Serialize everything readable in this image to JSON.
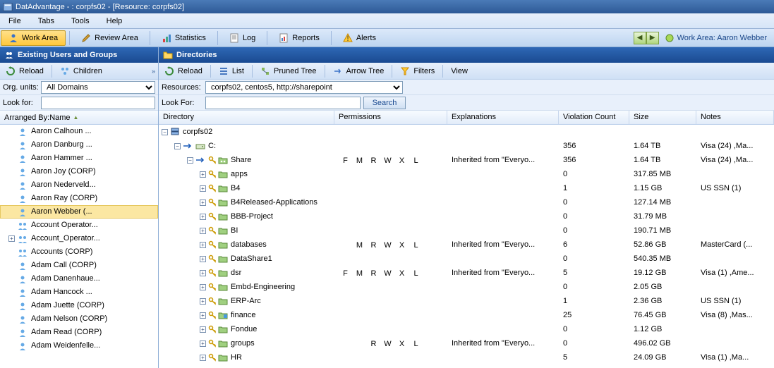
{
  "window_title": "DatAdvantage - : corpfs02 - [Resource: corpfs02]",
  "menu": [
    "File",
    "Tabs",
    "Tools",
    "Help"
  ],
  "toolbar": {
    "work_area": "Work Area",
    "review_area": "Review Area",
    "statistics": "Statistics",
    "log": "Log",
    "reports": "Reports",
    "alerts": "Alerts"
  },
  "work_area_label": "Work Area: Aaron Webber",
  "left": {
    "title": "Existing Users and Groups",
    "reload": "Reload",
    "children": "Children",
    "org_label": "Org. units:",
    "org_value": "All Domains",
    "look_label": "Look for:",
    "look_value": "",
    "arranged": "Arranged By:Name",
    "users": [
      {
        "name": "Aaron Calhoun ...",
        "type": "user"
      },
      {
        "name": "Aaron Danburg ...",
        "type": "user"
      },
      {
        "name": "Aaron Hammer ...",
        "type": "user"
      },
      {
        "name": "Aaron Joy (CORP)",
        "type": "user"
      },
      {
        "name": "Aaron Nederveld...",
        "type": "user"
      },
      {
        "name": "Aaron Ray (CORP)",
        "type": "user"
      },
      {
        "name": "Aaron Webber (...",
        "type": "user",
        "selected": true
      },
      {
        "name": "Account Operator...",
        "type": "group"
      },
      {
        "name": "Account_Operator...",
        "type": "group",
        "expandable": true
      },
      {
        "name": "Accounts (CORP)",
        "type": "group"
      },
      {
        "name": "Adam Call (CORP)",
        "type": "user"
      },
      {
        "name": "Adam Danenhaue...",
        "type": "user"
      },
      {
        "name": "Adam Hancock ...",
        "type": "user"
      },
      {
        "name": "Adam Juette (CORP)",
        "type": "user"
      },
      {
        "name": "Adam Nelson (CORP)",
        "type": "user"
      },
      {
        "name": "Adam Read (CORP)",
        "type": "user"
      },
      {
        "name": "Adam Weidenfelle...",
        "type": "user"
      }
    ]
  },
  "right": {
    "title": "Directories",
    "reload": "Reload",
    "list": "List",
    "pruned": "Pruned Tree",
    "arrow": "Arrow Tree",
    "filters": "Filters",
    "view": "View",
    "res_label": "Resources:",
    "res_value": "corpfs02, centos5, http://sharepoint",
    "look_label": "Look For:",
    "look_value": "",
    "search": "Search",
    "headers": {
      "dir": "Directory",
      "perm": "Permissions",
      "exp": "Explanations",
      "viol": "Violation Count",
      "size": "Size",
      "note": "Notes"
    }
  },
  "rows": [
    {
      "indent": 0,
      "exp": "-",
      "icon": "server",
      "name": "corpfs02",
      "perm": "",
      "expl": "",
      "viol": "",
      "size": "",
      "note": ""
    },
    {
      "indent": 1,
      "exp": "-",
      "arrow": true,
      "icon": "drive",
      "name": "C:",
      "perm": "",
      "expl": "",
      "viol": "356",
      "size": "1.64 TB",
      "note": "Visa (24) ,Ma..."
    },
    {
      "indent": 2,
      "exp": "-",
      "arrow": true,
      "icon": "share",
      "name": "Share",
      "perm": "FMRWXL",
      "expl": "Inherited from \"Everyo...",
      "viol": "356",
      "size": "1.64 TB",
      "note": "Visa (24) ,Ma..."
    },
    {
      "indent": 3,
      "exp": "+",
      "icon": "folder",
      "name": "apps",
      "perm": "",
      "expl": "",
      "viol": "0",
      "size": "317.85 MB",
      "note": ""
    },
    {
      "indent": 3,
      "exp": "+",
      "icon": "folder",
      "name": "B4",
      "perm": "",
      "expl": "",
      "viol": "1",
      "size": "1.15 GB",
      "note": "US SSN (1)"
    },
    {
      "indent": 3,
      "exp": "+",
      "icon": "folder",
      "name": "B4Released-Applications",
      "perm": "",
      "expl": "",
      "viol": "0",
      "size": "127.14 MB",
      "note": ""
    },
    {
      "indent": 3,
      "exp": "+",
      "icon": "folder",
      "name": "BBB-Project",
      "perm": "",
      "expl": "",
      "viol": "0",
      "size": "31.79 MB",
      "note": ""
    },
    {
      "indent": 3,
      "exp": "+",
      "icon": "folder",
      "name": "BI",
      "perm": "",
      "expl": "",
      "viol": "0",
      "size": "190.71 MB",
      "note": ""
    },
    {
      "indent": 3,
      "exp": "+",
      "icon": "folder",
      "name": "databases",
      "perm": " MRWXL",
      "expl": "Inherited from \"Everyo...",
      "viol": "6",
      "size": "52.86 GB",
      "note": "MasterCard (..."
    },
    {
      "indent": 3,
      "exp": "+",
      "icon": "folder",
      "name": "DataShare1",
      "perm": "",
      "expl": "",
      "viol": "0",
      "size": "540.35 MB",
      "note": ""
    },
    {
      "indent": 3,
      "exp": "+",
      "icon": "folder",
      "name": "dsr",
      "perm": "FMRWXL",
      "expl": "Inherited from \"Everyo...",
      "viol": "5",
      "size": "19.12 GB",
      "note": "Visa (1) ,Ame..."
    },
    {
      "indent": 3,
      "exp": "+",
      "icon": "folder",
      "name": "Embd-Engineering",
      "perm": "",
      "expl": "",
      "viol": "0",
      "size": "2.05 GB",
      "note": ""
    },
    {
      "indent": 3,
      "exp": "+",
      "icon": "folder",
      "name": "ERP-Arc",
      "perm": "",
      "expl": "",
      "viol": "1",
      "size": "2.36 GB",
      "note": "US SSN (1)"
    },
    {
      "indent": 3,
      "exp": "+",
      "icon": "folder-sp",
      "name": "finance",
      "perm": "",
      "expl": "",
      "viol": "25",
      "size": "76.45 GB",
      "note": "Visa (8) ,Mas..."
    },
    {
      "indent": 3,
      "exp": "+",
      "icon": "folder",
      "name": "Fondue",
      "perm": "",
      "expl": "",
      "viol": "0",
      "size": "1.12 GB",
      "note": ""
    },
    {
      "indent": 3,
      "exp": "+",
      "icon": "folder",
      "name": "groups",
      "perm": "  RWXL",
      "expl": "Inherited from \"Everyo...",
      "viol": "0",
      "size": "496.02 GB",
      "note": ""
    },
    {
      "indent": 3,
      "exp": "+",
      "icon": "folder",
      "name": "HR",
      "perm": "",
      "expl": "",
      "viol": "5",
      "size": "24.09 GB",
      "note": "Visa (1) ,Ma..."
    }
  ]
}
